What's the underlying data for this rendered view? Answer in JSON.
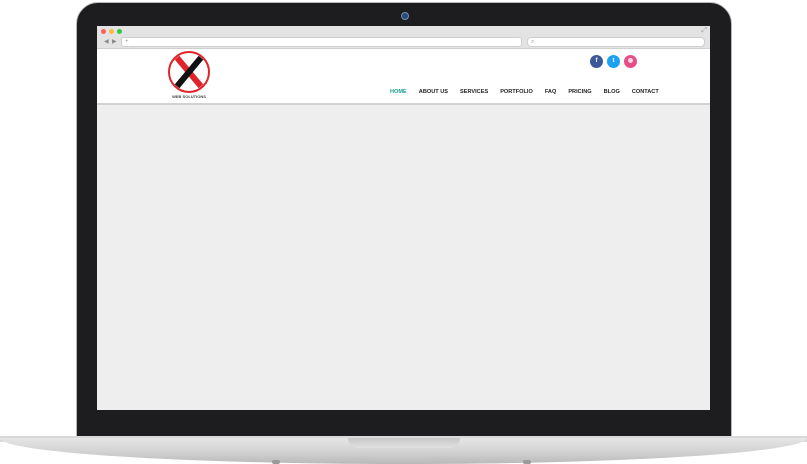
{
  "colors": {
    "accent": "#1a9e8a",
    "facebook": "#3b5998",
    "twitter": "#1da1f2",
    "dribbble": "#ea4c89",
    "logo_red": "#e0232b"
  },
  "browser": {
    "url_value": "",
    "search_value": ""
  },
  "logo": {
    "tagline": "WEB SOLUTIONS"
  },
  "social": [
    {
      "name": "facebook",
      "glyph": "f"
    },
    {
      "name": "twitter",
      "glyph": "t"
    },
    {
      "name": "dribbble",
      "glyph": "◍"
    }
  ],
  "nav": {
    "items": [
      {
        "label": "HOME",
        "active": true
      },
      {
        "label": "ABOUT US",
        "active": false
      },
      {
        "label": "SERVICES",
        "active": false
      },
      {
        "label": "PORTFOLIO",
        "active": false
      },
      {
        "label": "FAQ",
        "active": false
      },
      {
        "label": "PRICING",
        "active": false
      },
      {
        "label": "BLOG",
        "active": false
      },
      {
        "label": "CONTACT",
        "active": false
      }
    ]
  }
}
